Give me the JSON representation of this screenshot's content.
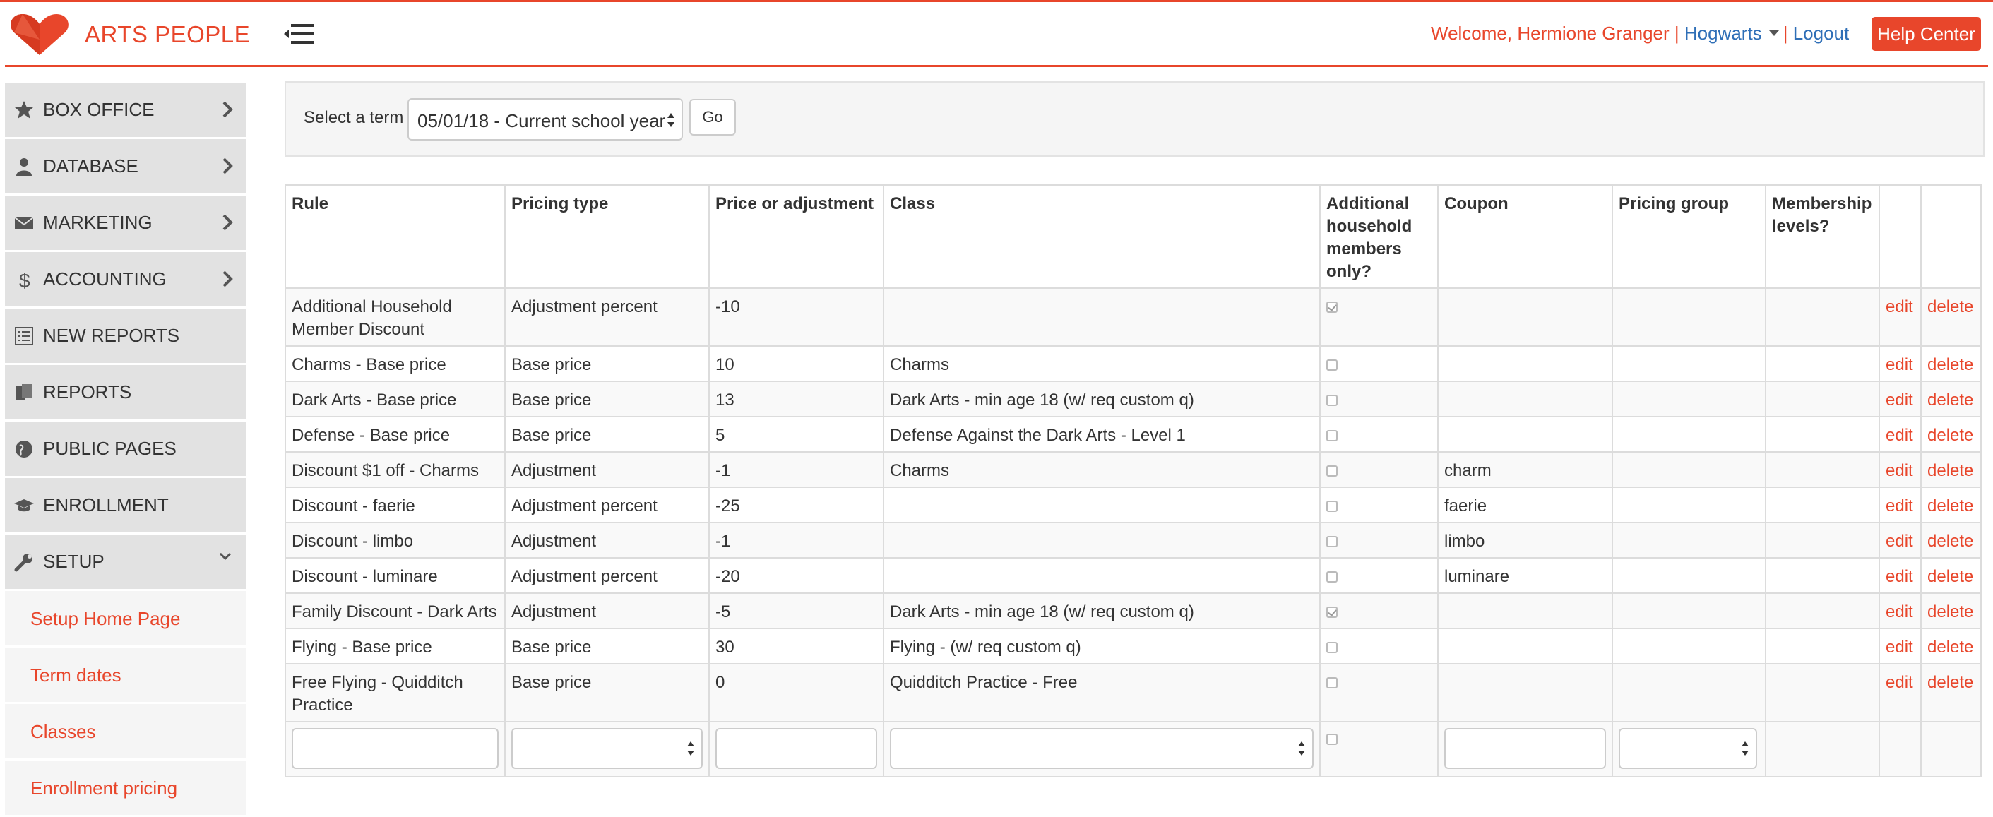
{
  "header": {
    "brand": "ARTS PEOPLE",
    "welcome_prefix": "Welcome, Hermione Granger |",
    "org": "Hogwarts",
    "separator": "|",
    "logout": "Logout",
    "help_center": "Help Center",
    "accent_color": "#e8462b"
  },
  "sidebar": {
    "items": [
      {
        "label": "BOX OFFICE",
        "icon": "star-icon"
      },
      {
        "label": "DATABASE",
        "icon": "person-icon"
      },
      {
        "label": "MARKETING",
        "icon": "envelope-icon"
      },
      {
        "label": "ACCOUNTING",
        "icon": "dollar-icon"
      },
      {
        "label": "NEW REPORTS",
        "icon": "list-icon"
      },
      {
        "label": "REPORTS",
        "icon": "documents-icon"
      },
      {
        "label": "PUBLIC PAGES",
        "icon": "globe-icon"
      },
      {
        "label": "ENROLLMENT",
        "icon": "graduation-cap-icon"
      },
      {
        "label": "SETUP",
        "icon": "wrench-icon"
      }
    ],
    "setup_subitems": [
      "Setup Home Page",
      "Term dates",
      "Classes",
      "Enrollment pricing"
    ]
  },
  "filter": {
    "label": "Select a term",
    "selected_term": "05/01/18 - Current school year",
    "go": "Go"
  },
  "table": {
    "headers": {
      "rule": "Rule",
      "pricing_type": "Pricing type",
      "price": "Price or adjustment",
      "class": "Class",
      "additional": "Additional household members only?",
      "coupon": "Coupon",
      "pricing_group": "Pricing group",
      "membership": "Membership levels?"
    },
    "edit_label": "edit",
    "delete_label": "delete",
    "rows": [
      {
        "rule": "Additional Household Member Discount",
        "pricing_type": "Adjustment percent",
        "price": "-10",
        "class": "",
        "additional": true,
        "coupon": "",
        "pricing_group": "",
        "membership": ""
      },
      {
        "rule": "Charms - Base price",
        "pricing_type": "Base price",
        "price": "10",
        "class": "Charms",
        "additional": false,
        "coupon": "",
        "pricing_group": "",
        "membership": ""
      },
      {
        "rule": "Dark Arts - Base price",
        "pricing_type": "Base price",
        "price": "13",
        "class": "Dark Arts - min age 18 (w/ req custom q)",
        "additional": false,
        "coupon": "",
        "pricing_group": "",
        "membership": ""
      },
      {
        "rule": "Defense - Base price",
        "pricing_type": "Base price",
        "price": "5",
        "class": "Defense Against the Dark Arts - Level 1",
        "additional": false,
        "coupon": "",
        "pricing_group": "",
        "membership": ""
      },
      {
        "rule": "Discount $1 off - Charms",
        "pricing_type": "Adjustment",
        "price": "-1",
        "class": "Charms",
        "additional": false,
        "coupon": "charm",
        "pricing_group": "",
        "membership": ""
      },
      {
        "rule": "Discount - faerie",
        "pricing_type": "Adjustment percent",
        "price": "-25",
        "class": "",
        "additional": false,
        "coupon": "faerie",
        "pricing_group": "",
        "membership": ""
      },
      {
        "rule": "Discount - limbo",
        "pricing_type": "Adjustment",
        "price": "-1",
        "class": "",
        "additional": false,
        "coupon": "limbo",
        "pricing_group": "",
        "membership": ""
      },
      {
        "rule": "Discount - luminare",
        "pricing_type": "Adjustment percent",
        "price": "-20",
        "class": "",
        "additional": false,
        "coupon": "luminare",
        "pricing_group": "",
        "membership": ""
      },
      {
        "rule": "Family Discount - Dark Arts",
        "pricing_type": "Adjustment",
        "price": "-5",
        "class": "Dark Arts - min age 18 (w/ req custom q)",
        "additional": true,
        "coupon": "",
        "pricing_group": "",
        "membership": ""
      },
      {
        "rule": "Flying - Base price",
        "pricing_type": "Base price",
        "price": "30",
        "class": "Flying - (w/ req custom q)",
        "additional": false,
        "coupon": "",
        "pricing_group": "",
        "membership": ""
      },
      {
        "rule": "Free Flying - Quidditch Practice",
        "pricing_type": "Base price",
        "price": "0",
        "class": "Quidditch Practice - Free",
        "additional": false,
        "coupon": "",
        "pricing_group": "",
        "membership": ""
      }
    ]
  }
}
